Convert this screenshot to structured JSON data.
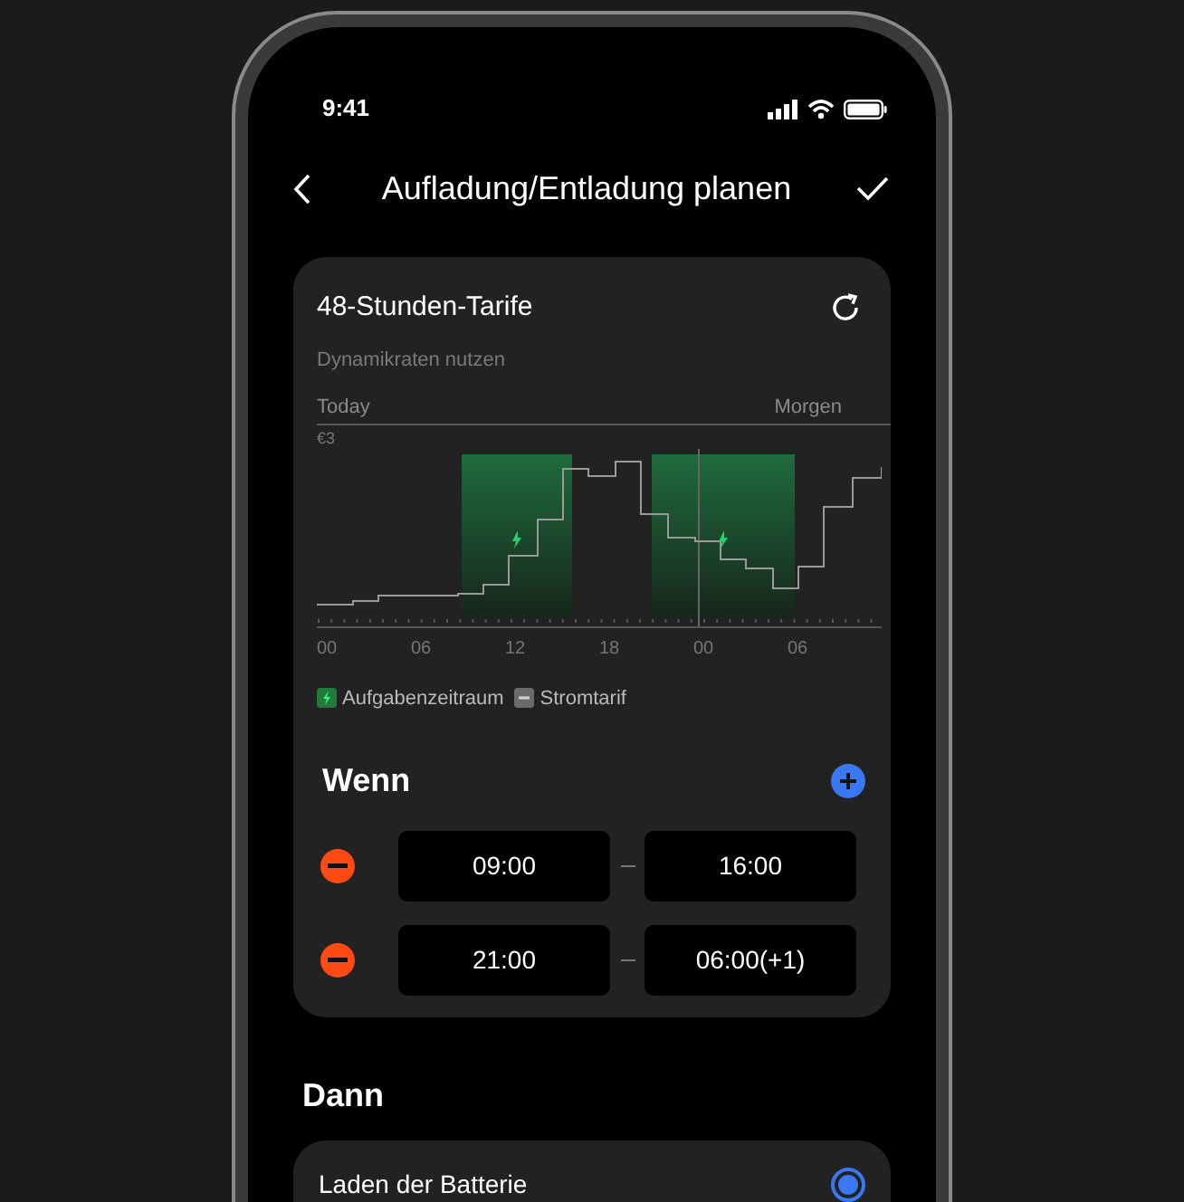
{
  "status_bar": {
    "time": "9:41"
  },
  "header": {
    "title": "Aufladung/Entladung planen"
  },
  "tariff_card": {
    "title": "48-Stunden-Tarife",
    "subtitle": "Dynamikraten nutzen",
    "chart": {
      "today_label": "Today",
      "tomorrow_label": "Morgen",
      "y_label": "€3",
      "x_labels": [
        "00",
        "06",
        "12",
        "18",
        "00",
        "06"
      ]
    },
    "legend": [
      {
        "kind": "task",
        "label": "Aufgabenzeitraum"
      },
      {
        "kind": "tariff",
        "label": "Stromtarif"
      }
    ]
  },
  "wenn": {
    "title": "Wenn",
    "rows": [
      {
        "start": "09:00",
        "end": "16:00"
      },
      {
        "start": "21:00",
        "end": "06:00(+1)"
      }
    ]
  },
  "dann": {
    "title": "Dann",
    "options": [
      {
        "label": "Laden der Batterie",
        "selected": true
      }
    ]
  }
}
